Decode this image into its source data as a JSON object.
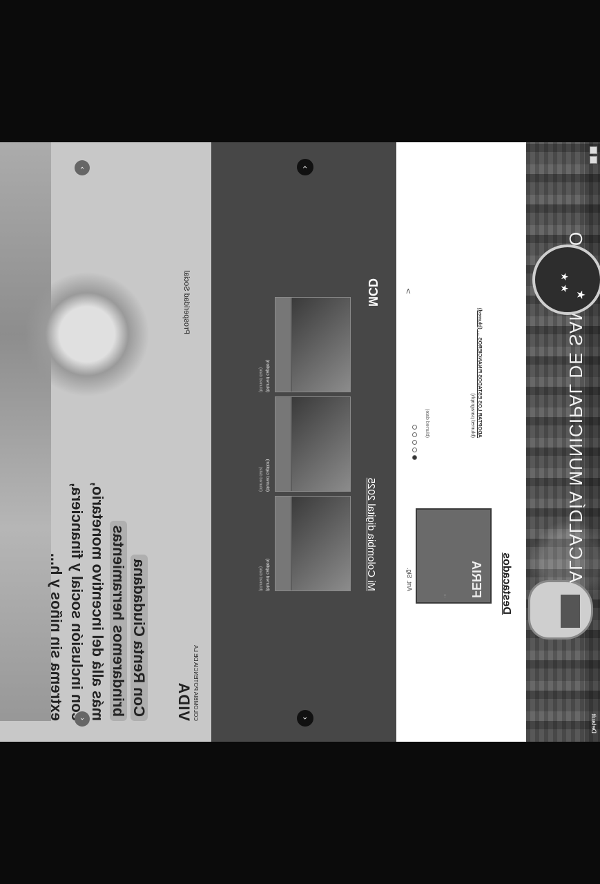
{
  "header": {
    "title": "ALCALDÍA MUNICIPAL DE SAMANIEGO",
    "lang_label": "Default"
  },
  "destacados": {
    "title": "Destacados",
    "poster": {
      "big_text": "FERIA",
      "small_text": "…"
    },
    "poster_nav": "Ant. Sig.",
    "news_title": "ADOPTAR LOS ESTADOS FINANCIEROS … (blurred)",
    "news_text": "(blurred paragraph)",
    "news_date": "(blurred date)"
  },
  "mi_colombia": {
    "title": "Mi Colombia digital 2025",
    "logo": "MCD",
    "cards": [
      {
        "caption": "(blurred caption)",
        "date": "(blurred date)"
      },
      {
        "caption": "(blurred caption)",
        "date": "(blurred date)"
      },
      {
        "caption": "(blurred caption)",
        "date": "(blurred date)"
      }
    ]
  },
  "renta": {
    "logo_top": "COLOMBIA POTENCIA DE LA",
    "logo_main": "VIDA",
    "partner": "Prosperidad Social",
    "headline_l1": "Con Renta Ciudadana",
    "headline_l2": "brindaremos herramientas",
    "headline_l3": "más allá del incentivo monetario,",
    "headline_l4": "con inclusión social y financiera,",
    "headline_l5": "extrema sin niños y h..."
  },
  "colors": {
    "hero": "#4f4f4f",
    "dark_section": "#474747",
    "light_section": "#c8c8c8"
  }
}
